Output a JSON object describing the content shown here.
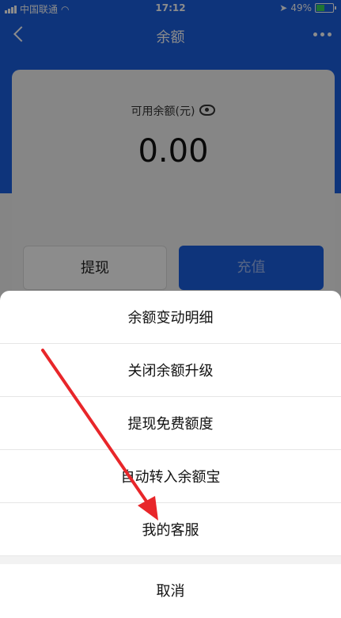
{
  "status": {
    "carrier": "中国联通",
    "time": "17:12",
    "battery": "49%"
  },
  "nav": {
    "title": "余额"
  },
  "balance": {
    "label": "可用余额(元)",
    "amount": "0.00"
  },
  "actions": {
    "withdraw": "提现",
    "recharge": "充值"
  },
  "sheet": {
    "items": [
      "余额变动明细",
      "关闭余额升级",
      "提现免费额度",
      "自动转入余额宝",
      "我的客服"
    ],
    "cancel": "取消"
  },
  "colors": {
    "primary": "#1b5fe0",
    "arrow": "#e8262a"
  }
}
